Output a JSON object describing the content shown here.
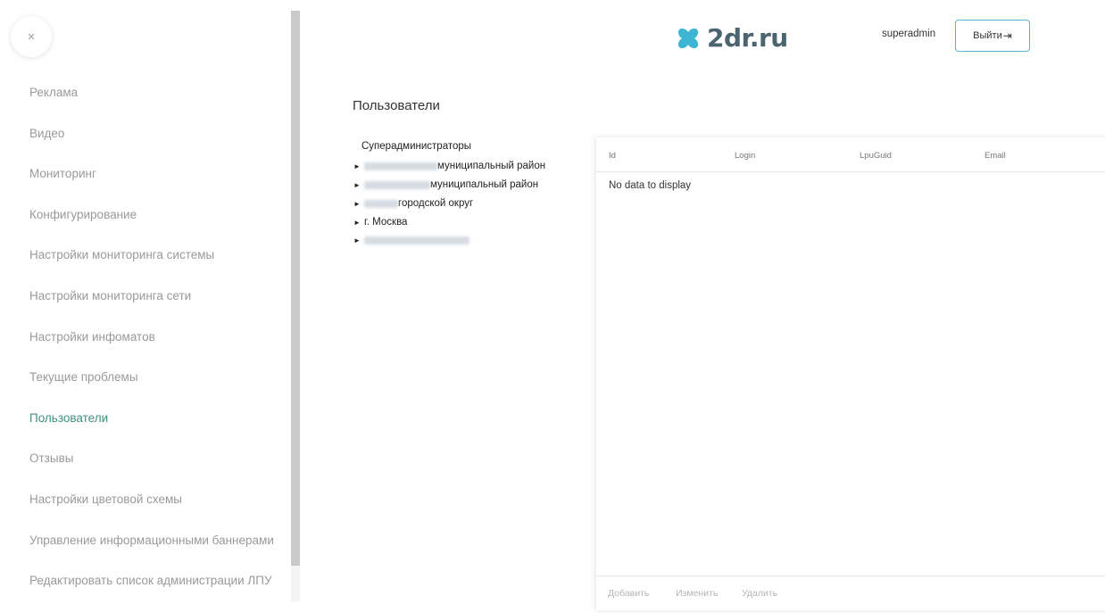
{
  "sidebar": {
    "close_glyph": "×",
    "items": [
      {
        "label": "Реклама",
        "active": false
      },
      {
        "label": "Видео",
        "active": false
      },
      {
        "label": "Мониторинг",
        "active": false
      },
      {
        "label": "Конфигурирование",
        "active": false
      },
      {
        "label": "Настройки мониторинга системы",
        "active": false
      },
      {
        "label": "Настройки мониторинга сети",
        "active": false
      },
      {
        "label": "Настройки инфоматов",
        "active": false
      },
      {
        "label": "Текущие проблемы",
        "active": false
      },
      {
        "label": "Пользователи",
        "active": true
      },
      {
        "label": "Отзывы",
        "active": false
      },
      {
        "label": "Настройки цветовой схемы",
        "active": false
      },
      {
        "label": "Управление информационными баннерами",
        "active": false
      },
      {
        "label": "Редактировать список администрации ЛПУ",
        "active": false
      }
    ]
  },
  "header": {
    "logo_text": "2dr.ru",
    "logo_icon": "clover-icon",
    "brand_color": "#3fb5d4",
    "username": "superadmin",
    "logout_label": "Выйти",
    "logout_icon": "logout-icon"
  },
  "page": {
    "title": "Пользователи"
  },
  "tree": {
    "root": "Суперадминистраторы",
    "nodes": [
      {
        "label": "муниципальный район",
        "redacted": true
      },
      {
        "label": "муниципальный район",
        "redacted": true
      },
      {
        "label": "городской округ",
        "redacted": true
      },
      {
        "label": "г. Москва",
        "redacted": false
      },
      {
        "label": "",
        "redacted": true
      }
    ]
  },
  "table": {
    "columns": [
      "Id",
      "Login",
      "LpuGuid",
      "Email"
    ],
    "empty_text": "No data to display",
    "actions": [
      "Добавить",
      "Изменить",
      "Удалить"
    ]
  },
  "colors": {
    "active_menu": "#3e8f7d",
    "menu_text": "#9a9a9a",
    "button_border": "#5bb3d0"
  }
}
